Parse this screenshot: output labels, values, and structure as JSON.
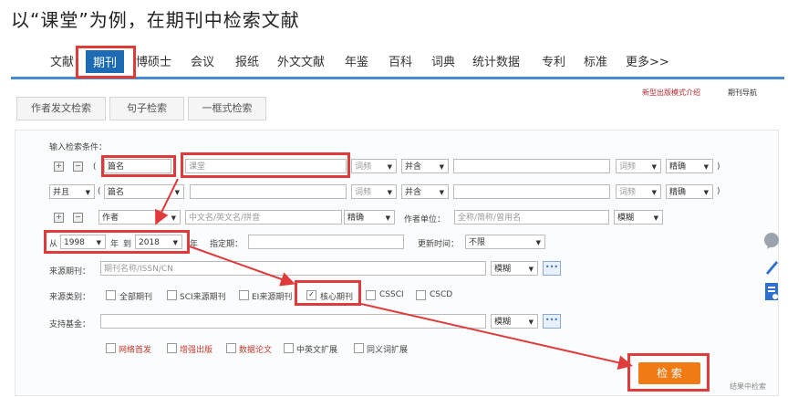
{
  "heading": "以“课堂”为例，在期刊中检索文献",
  "nav": {
    "items": [
      "文献",
      "期刊",
      "博硕士",
      "会议",
      "报纸",
      "外文文献",
      "年鉴",
      "百科",
      "词典",
      "统计数据",
      "专利",
      "标准",
      "更多>>"
    ],
    "active_index": 1
  },
  "top_links": {
    "new_mode": "新型出版模式介绍",
    "journal_nav": "期刊导航"
  },
  "tabs": [
    "作者发文检索",
    "句子检索",
    "一框式检索"
  ],
  "form": {
    "title": "输入检索条件：",
    "row1": {
      "field": "篇名",
      "value": "课堂",
      "freq": "词频",
      "logic": "并含",
      "freq2": "词频",
      "match": "精确"
    },
    "row2": {
      "logic": "并且",
      "field": "篇名",
      "freq": "词频",
      "logic2": "并含",
      "freq2": "词频",
      "match": "精确"
    },
    "row3": {
      "field": "作者",
      "placeholder": "中文名/英文名/拼音",
      "match": "精确",
      "unit_label": "作者单位：",
      "unit_placeholder": "全称/简称/曾用名",
      "match2": "模糊"
    },
    "row4": {
      "from": "从",
      "year_from": "1998",
      "year_label": "年",
      "to": "到",
      "year_to": "2018",
      "year_label2": "年",
      "issue_label": "指定期：",
      "update_label": "更新时间：",
      "update_value": "不限"
    },
    "source": {
      "label": "来源期刊：",
      "placeholder": "期刊名称/ISSN/CN",
      "match": "模糊"
    },
    "category": {
      "label": "来源类别：",
      "options": [
        "全部期刊",
        "SCI来源期刊",
        "EI来源期刊",
        "核心期刊",
        "CSSCI",
        "CSCD"
      ],
      "checked_index": 3
    },
    "fund": {
      "label": "支持基金：",
      "match": "模糊"
    },
    "extras": [
      "网络首发",
      "增强出版",
      "数据论文",
      "中英文扩展",
      "同义词扩展"
    ],
    "bracket_close": ")"
  },
  "search_button": "检 索",
  "result_link": "结果中检索",
  "colors": {
    "nav_active": "#1c6bb3",
    "nav_line": "#4a8bd4",
    "highlight": "#e03b3b",
    "search_btn": "#f07a13"
  },
  "icons": [
    "expand-icon",
    "collapse-icon",
    "comment-icon",
    "pen-icon",
    "document-icon"
  ]
}
